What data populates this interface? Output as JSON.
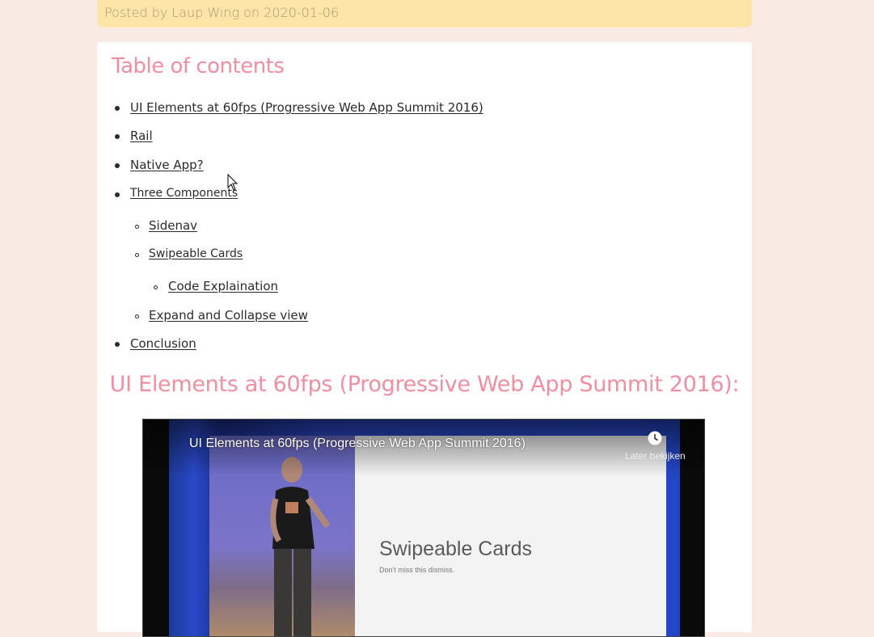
{
  "post_meta": {
    "prefix": "Posted by",
    "author": "Laup Wing",
    "on": "on",
    "date": "2020-01-06"
  },
  "toc": {
    "title": "Table of contents",
    "items": [
      {
        "label": "UI Elements at 60fps (Progressive Web App Summit 2016)"
      },
      {
        "label": "Rail"
      },
      {
        "label": "Native App?"
      },
      {
        "label": "Three Components"
      },
      {
        "label": "Sidenav"
      },
      {
        "label": "Swipeable Cards"
      },
      {
        "label": "Code Explaination"
      },
      {
        "label": "Expand and Collapse view"
      },
      {
        "label": "Conclusion"
      }
    ]
  },
  "section": {
    "heading": "UI Elements at 60fps (Progressive Web App Summit 2016):"
  },
  "video": {
    "title": "UI Elements at 60fps (Progressive Web App Summit 2016)",
    "watch_later": "Later bekijken",
    "slide_title": "Swipeable Cards",
    "slide_subtitle": "Don't miss this dismiss."
  },
  "colors": {
    "page_bg": "#f9ebe4",
    "meta_bar": "#fde4a7",
    "accent_pink": "#ef8fa2"
  }
}
